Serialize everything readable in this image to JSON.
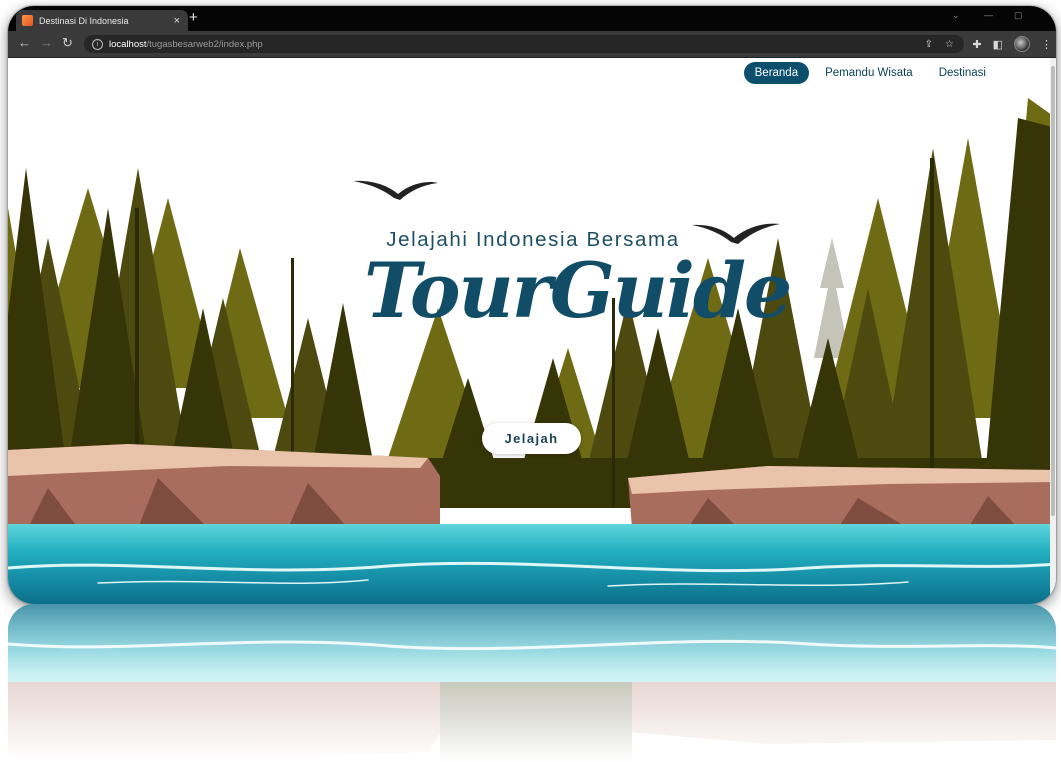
{
  "browser": {
    "tab_title": "Destinasi Di Indonesia",
    "tab_close": "×",
    "new_tab": "+",
    "url_host": "localhost",
    "url_path": "/tugasbesarweb2/index.php"
  },
  "nav": {
    "items": [
      {
        "label": "Beranda",
        "active": true
      },
      {
        "label": "Pemandu Wisata",
        "active": false
      },
      {
        "label": "Destinasi",
        "active": false
      }
    ]
  },
  "hero": {
    "subtitle": "Jelajahi Indonesia Bersama",
    "title": "TourGuide",
    "button_label": "Jelajah"
  },
  "colors": {
    "primary": "#0b4f6c",
    "title_text": "#114d67",
    "forest_olive": "#6f6b14",
    "forest_dark": "#3a3a09",
    "water": "#1a9fb6",
    "cliff": "#c89580"
  },
  "icons": [
    "back-arrow-icon",
    "forward-arrow-icon",
    "reload-icon",
    "info-icon",
    "share-icon",
    "star-icon",
    "extensions-icon",
    "sidebar-icon",
    "profile-avatar",
    "menu-dots-icon"
  ]
}
